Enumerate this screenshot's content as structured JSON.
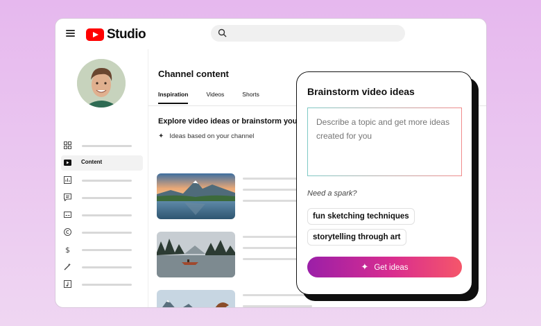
{
  "app": {
    "logo_text": "Studio"
  },
  "sidebar": {
    "active_label": "Content"
  },
  "main": {
    "title": "Channel content",
    "tabs": [
      {
        "label": "Inspiration"
      },
      {
        "label": "Videos"
      },
      {
        "label": "Shorts"
      }
    ],
    "explore_heading": "Explore video ideas or brainstorm you",
    "ideas_subtitle": "Ideas based on your channel"
  },
  "brainstorm": {
    "title": "Brainstorm video ideas",
    "placeholder": "Describe a topic and get more ideas created for you",
    "spark_label": "Need a spark?",
    "suggestions": [
      {
        "label": "fun sketching techniques"
      },
      {
        "label": "storytelling through art"
      }
    ],
    "button_label": "Get ideas"
  },
  "colors": {
    "brand_red": "#ff0000",
    "gradient_start": "#9b1fa8",
    "gradient_end": "#f5566a"
  }
}
